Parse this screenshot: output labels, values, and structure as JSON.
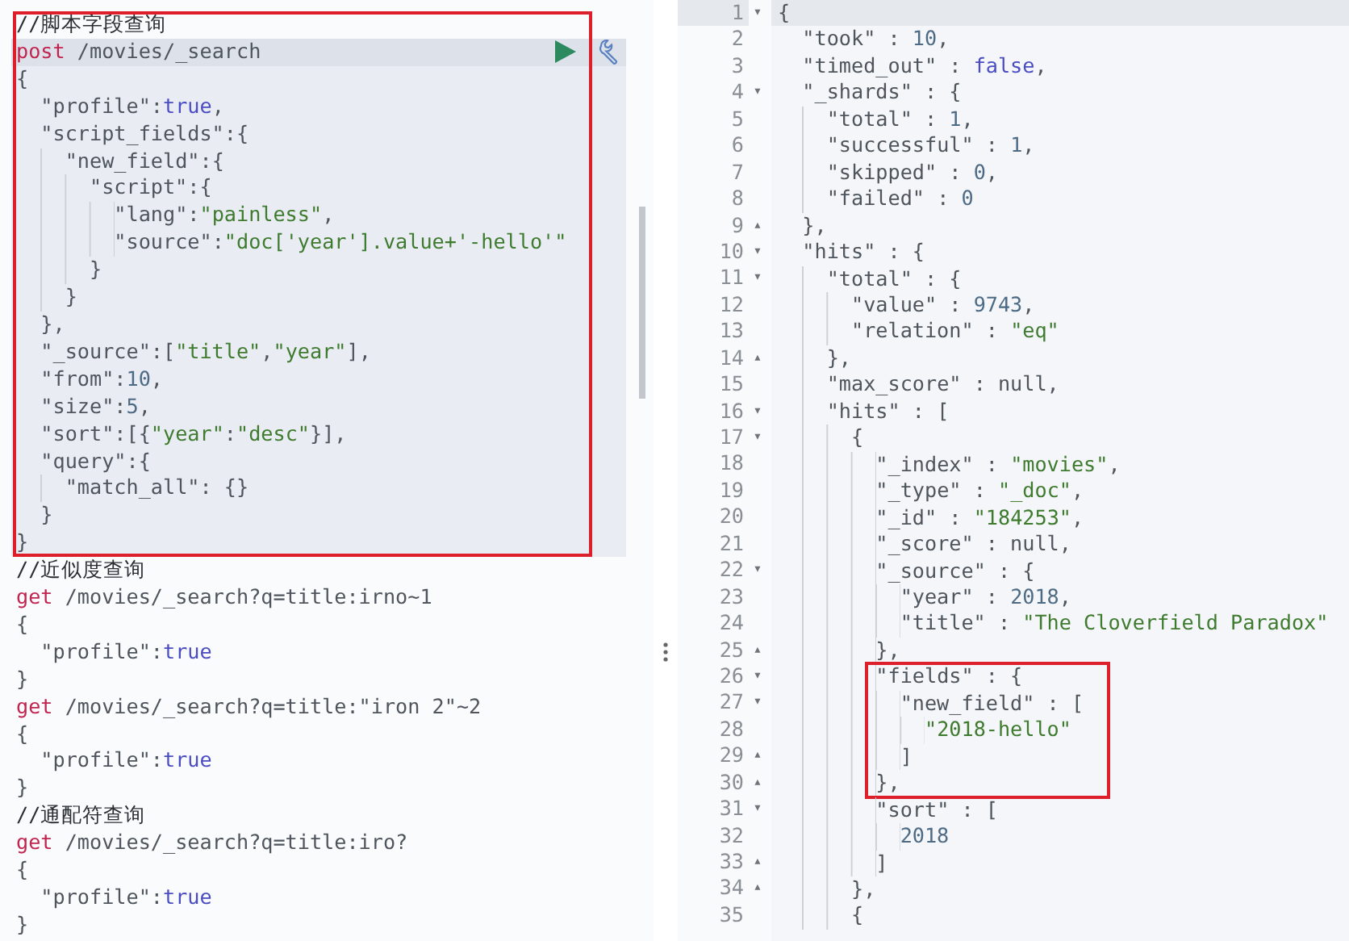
{
  "editor": {
    "requests": [
      {
        "comment": "//脚本字段查询",
        "selected": true,
        "annotated": true,
        "lines": [
          {
            "tokens": [
              {
                "kind": "method",
                "text": "post"
              },
              {
                "kind": "plain",
                "text": " /movies/_search"
              }
            ]
          },
          {
            "tokens": [
              {
                "kind": "plain",
                "text": "{"
              }
            ]
          },
          {
            "tokens": [
              {
                "kind": "plain",
                "text": "  \"profile\":"
              },
              {
                "kind": "literal",
                "text": "true"
              },
              {
                "kind": "plain",
                "text": ","
              }
            ]
          },
          {
            "tokens": [
              {
                "kind": "plain",
                "text": "  \"script_fields\":{"
              }
            ]
          },
          {
            "tokens": [
              {
                "kind": "plain",
                "text": "    \"new_field\":{"
              }
            ]
          },
          {
            "tokens": [
              {
                "kind": "plain",
                "text": "      \"script\":{"
              }
            ]
          },
          {
            "tokens": [
              {
                "kind": "plain",
                "text": "        \"lang\":"
              },
              {
                "kind": "string",
                "text": "\"painless\""
              },
              {
                "kind": "plain",
                "text": ","
              }
            ]
          },
          {
            "tokens": [
              {
                "kind": "plain",
                "text": "        \"source\":"
              },
              {
                "kind": "string",
                "text": "\"doc['year'].value+'-hello'\""
              }
            ]
          },
          {
            "tokens": [
              {
                "kind": "plain",
                "text": "      }"
              }
            ]
          },
          {
            "tokens": [
              {
                "kind": "plain",
                "text": "    }"
              }
            ]
          },
          {
            "tokens": [
              {
                "kind": "plain",
                "text": "  },"
              }
            ]
          },
          {
            "tokens": [
              {
                "kind": "plain",
                "text": "  \"_source\":["
              },
              {
                "kind": "string",
                "text": "\"title\""
              },
              {
                "kind": "plain",
                "text": ","
              },
              {
                "kind": "string",
                "text": "\"year\""
              },
              {
                "kind": "plain",
                "text": "],"
              }
            ]
          },
          {
            "tokens": [
              {
                "kind": "plain",
                "text": "  \"from\":"
              },
              {
                "kind": "number",
                "text": "10"
              },
              {
                "kind": "plain",
                "text": ","
              }
            ]
          },
          {
            "tokens": [
              {
                "kind": "plain",
                "text": "  \"size\":"
              },
              {
                "kind": "number",
                "text": "5"
              },
              {
                "kind": "plain",
                "text": ","
              }
            ]
          },
          {
            "tokens": [
              {
                "kind": "plain",
                "text": "  \"sort\":[{"
              },
              {
                "kind": "string",
                "text": "\"year\""
              },
              {
                "kind": "plain",
                "text": ":"
              },
              {
                "kind": "string",
                "text": "\"desc\""
              },
              {
                "kind": "plain",
                "text": "}],"
              }
            ]
          },
          {
            "tokens": [
              {
                "kind": "plain",
                "text": "  \"query\":{"
              }
            ]
          },
          {
            "tokens": [
              {
                "kind": "plain",
                "text": "    \"match_all\": {}"
              }
            ]
          },
          {
            "tokens": [
              {
                "kind": "plain",
                "text": "  }"
              }
            ]
          },
          {
            "tokens": [
              {
                "kind": "plain",
                "text": "}"
              }
            ]
          }
        ]
      },
      {
        "comment": "//近似度查询",
        "selected": false,
        "annotated": false,
        "lines": [
          {
            "tokens": [
              {
                "kind": "method",
                "text": "get"
              },
              {
                "kind": "plain",
                "text": " /movies/_search?q=title:irno~1"
              }
            ]
          },
          {
            "tokens": [
              {
                "kind": "plain",
                "text": "{"
              }
            ]
          },
          {
            "tokens": [
              {
                "kind": "plain",
                "text": "  \"profile\":"
              },
              {
                "kind": "literal",
                "text": "true"
              }
            ]
          },
          {
            "tokens": [
              {
                "kind": "plain",
                "text": "}"
              }
            ]
          }
        ]
      },
      {
        "selected": false,
        "annotated": false,
        "lines": [
          {
            "tokens": [
              {
                "kind": "method",
                "text": "get"
              },
              {
                "kind": "plain",
                "text": " /movies/_search?q=title:\"iron 2\"~2"
              }
            ]
          },
          {
            "tokens": [
              {
                "kind": "plain",
                "text": "{"
              }
            ]
          },
          {
            "tokens": [
              {
                "kind": "plain",
                "text": "  \"profile\":"
              },
              {
                "kind": "literal",
                "text": "true"
              }
            ]
          },
          {
            "tokens": [
              {
                "kind": "plain",
                "text": "}"
              }
            ]
          }
        ]
      },
      {
        "comment": "//通配符查询",
        "selected": false,
        "annotated": false,
        "lines": [
          {
            "tokens": [
              {
                "kind": "method",
                "text": "get"
              },
              {
                "kind": "plain",
                "text": " /movies/_search?q=title:iro?"
              }
            ]
          },
          {
            "tokens": [
              {
                "kind": "plain",
                "text": "{"
              }
            ]
          },
          {
            "tokens": [
              {
                "kind": "plain",
                "text": "  \"profile\":"
              },
              {
                "kind": "literal",
                "text": "true"
              }
            ]
          },
          {
            "tokens": [
              {
                "kind": "plain",
                "text": "}"
              }
            ]
          }
        ]
      }
    ]
  },
  "response": {
    "blocks": [
      {
        "annotated": false,
        "lines": [
          {
            "number": "1",
            "active": true,
            "fold": "▾",
            "tokens": [
              {
                "kind": "plain",
                "text": "{"
              }
            ]
          },
          {
            "number": "2",
            "active": false,
            "tokens": [
              {
                "kind": "plain",
                "text": "  \"took\" : "
              },
              {
                "kind": "number",
                "text": "10"
              },
              {
                "kind": "plain",
                "text": ","
              }
            ]
          },
          {
            "number": "3",
            "active": false,
            "tokens": [
              {
                "kind": "plain",
                "text": "  \"timed_out\" : "
              },
              {
                "kind": "literal",
                "text": "false"
              },
              {
                "kind": "plain",
                "text": ","
              }
            ]
          },
          {
            "number": "4",
            "active": false,
            "fold": "▾",
            "tokens": [
              {
                "kind": "plain",
                "text": "  \"_shards\" : {"
              }
            ]
          },
          {
            "number": "5",
            "active": false,
            "tokens": [
              {
                "kind": "plain",
                "text": "    \"total\" : "
              },
              {
                "kind": "number",
                "text": "1"
              },
              {
                "kind": "plain",
                "text": ","
              }
            ]
          },
          {
            "number": "6",
            "active": false,
            "tokens": [
              {
                "kind": "plain",
                "text": "    \"successful\" : "
              },
              {
                "kind": "number",
                "text": "1"
              },
              {
                "kind": "plain",
                "text": ","
              }
            ]
          },
          {
            "number": "7",
            "active": false,
            "tokens": [
              {
                "kind": "plain",
                "text": "    \"skipped\" : "
              },
              {
                "kind": "number",
                "text": "0"
              },
              {
                "kind": "plain",
                "text": ","
              }
            ]
          },
          {
            "number": "8",
            "active": false,
            "tokens": [
              {
                "kind": "plain",
                "text": "    \"failed\" : "
              },
              {
                "kind": "number",
                "text": "0"
              }
            ]
          },
          {
            "number": "9",
            "active": false,
            "fold": "▴",
            "tokens": [
              {
                "kind": "plain",
                "text": "  },"
              }
            ]
          },
          {
            "number": "10",
            "active": false,
            "fold": "▾",
            "tokens": [
              {
                "kind": "plain",
                "text": "  \"hits\" : {"
              }
            ]
          },
          {
            "number": "11",
            "active": false,
            "fold": "▾",
            "tokens": [
              {
                "kind": "plain",
                "text": "    \"total\" : {"
              }
            ]
          },
          {
            "number": "12",
            "active": false,
            "tokens": [
              {
                "kind": "plain",
                "text": "      \"value\" : "
              },
              {
                "kind": "number",
                "text": "9743"
              },
              {
                "kind": "plain",
                "text": ","
              }
            ]
          },
          {
            "number": "13",
            "active": false,
            "tokens": [
              {
                "kind": "plain",
                "text": "      \"relation\" : "
              },
              {
                "kind": "string",
                "text": "\"eq\""
              }
            ]
          },
          {
            "number": "14",
            "active": false,
            "fold": "▴",
            "tokens": [
              {
                "kind": "plain",
                "text": "    },"
              }
            ]
          },
          {
            "number": "15",
            "active": false,
            "tokens": [
              {
                "kind": "plain",
                "text": "    \"max_score\" : null,"
              }
            ]
          },
          {
            "number": "16",
            "active": false,
            "fold": "▾",
            "tokens": [
              {
                "kind": "plain",
                "text": "    \"hits\" : ["
              }
            ]
          },
          {
            "number": "17",
            "active": false,
            "fold": "▾",
            "tokens": [
              {
                "kind": "plain",
                "text": "      {"
              }
            ]
          },
          {
            "number": "18",
            "active": false,
            "tokens": [
              {
                "kind": "plain",
                "text": "        \"_index\" : "
              },
              {
                "kind": "string",
                "text": "\"movies\""
              },
              {
                "kind": "plain",
                "text": ","
              }
            ]
          },
          {
            "number": "19",
            "active": false,
            "tokens": [
              {
                "kind": "plain",
                "text": "        \"_type\" : "
              },
              {
                "kind": "string",
                "text": "\"_doc\""
              },
              {
                "kind": "plain",
                "text": ","
              }
            ]
          },
          {
            "number": "20",
            "active": false,
            "tokens": [
              {
                "kind": "plain",
                "text": "        \"_id\" : "
              },
              {
                "kind": "string",
                "text": "\"184253\""
              },
              {
                "kind": "plain",
                "text": ","
              }
            ]
          },
          {
            "number": "21",
            "active": false,
            "tokens": [
              {
                "kind": "plain",
                "text": "        \"_score\" : null,"
              }
            ]
          },
          {
            "number": "22",
            "active": false,
            "fold": "▾",
            "tokens": [
              {
                "kind": "plain",
                "text": "        \"_source\" : {"
              }
            ]
          },
          {
            "number": "23",
            "active": false,
            "tokens": [
              {
                "kind": "plain",
                "text": "          \"year\" : "
              },
              {
                "kind": "number",
                "text": "2018"
              },
              {
                "kind": "plain",
                "text": ","
              }
            ]
          },
          {
            "number": "24",
            "active": false,
            "tokens": [
              {
                "kind": "plain",
                "text": "          \"title\" : "
              },
              {
                "kind": "string",
                "text": "\"The Cloverfield Paradox\""
              }
            ]
          },
          {
            "number": "25",
            "active": false,
            "fold": "▴",
            "tokens": [
              {
                "kind": "plain",
                "text": "        },"
              }
            ]
          }
        ]
      },
      {
        "annotated": true,
        "lines": [
          {
            "number": "26",
            "active": false,
            "fold": "▾",
            "tokens": [
              {
                "kind": "plain",
                "text": "        \"fields\" : {"
              }
            ]
          },
          {
            "number": "27",
            "active": false,
            "fold": "▾",
            "tokens": [
              {
                "kind": "plain",
                "text": "          \"new_field\" : ["
              }
            ]
          },
          {
            "number": "28",
            "active": false,
            "tokens": [
              {
                "kind": "string",
                "text": "            \"2018-hello\""
              }
            ]
          },
          {
            "number": "29",
            "active": false,
            "fold": "▴",
            "tokens": [
              {
                "kind": "plain",
                "text": "          ]"
              }
            ]
          },
          {
            "number": "30",
            "active": false,
            "fold": "▴",
            "tokens": [
              {
                "kind": "plain",
                "text": "        },"
              }
            ]
          }
        ]
      },
      {
        "annotated": false,
        "lines": [
          {
            "number": "31",
            "active": false,
            "fold": "▾",
            "tokens": [
              {
                "kind": "plain",
                "text": "        \"sort\" : ["
              }
            ]
          },
          {
            "number": "32",
            "active": false,
            "tokens": [
              {
                "kind": "number",
                "text": "          2018"
              }
            ]
          },
          {
            "number": "33",
            "active": false,
            "fold": "▴",
            "tokens": [
              {
                "kind": "plain",
                "text": "        ]"
              }
            ]
          },
          {
            "number": "34",
            "active": false,
            "fold": "▴",
            "tokens": [
              {
                "kind": "plain",
                "text": "      },"
              }
            ]
          },
          {
            "number": "35",
            "active": false,
            "tokens": [
              {
                "kind": "plain",
                "text": "      {"
              }
            ]
          }
        ]
      }
    ]
  }
}
